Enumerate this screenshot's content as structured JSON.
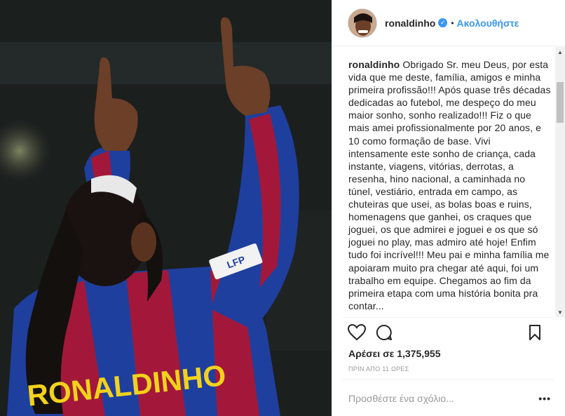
{
  "post": {
    "image_alt": "Ronaldinho pointing upward in a Barcelona jersey",
    "jersey_text": "RONALDINHO",
    "sleeve_badge": "LFP"
  },
  "header": {
    "username": "ronaldinho",
    "verified_icon": "verified-badge-icon",
    "separator": "•",
    "follow_label": "Ακολουθήστε"
  },
  "caption": {
    "username": "ronaldinho",
    "text": "Obrigado Sr. meu Deus, por esta vida que me deste, família, amigos e minha primeira profissão!!! Após quase três décadas dedicadas ao futebol, me despeço do meu maior sonho, sonho realizado!!! Fiz o que mais amei profissionalmente por 20 anos, e 10 como formação de base. Vivi intensamente este sonho de criança, cada instante, viagens, vitórias, derrotas, a resenha, hino nacional, a caminhada no túnel, vestiário, entrada em campo, as chuteiras que usei, as bolas boas e ruins, homenagens que ganhei, os craques que joguei, os que admirei e joguei e os que só joguei no play, mas admiro até hoje! Enfim tudo foi incrível!!! Meu pai e minha família me apoiaram muito pra chegar até aqui, foi um trabalho em equipe. Chegamos ao fim da primeira etapa com uma história bonita pra contar..."
  },
  "scrollbar": {
    "up_glyph": "▲",
    "down_glyph": "▼"
  },
  "actions": {
    "like_icon": "heart-icon",
    "comment_icon": "comment-bubble-icon",
    "save_icon": "bookmark-icon"
  },
  "likes_text": "Αρέσει σε 1,375,955",
  "timestamp": "ΠΡΙΝ ΑΠΟ 11 ΩΡΕΣ",
  "comment": {
    "placeholder": "Προσθέστε ένα σχόλιο...",
    "more_label": "•••"
  },
  "colors": {
    "accent": "#3897f0",
    "text": "#262626",
    "muted": "#999999",
    "jersey_blue": "#1f3f9e",
    "jersey_red": "#a3183a",
    "jersey_yellow": "#f2d21b"
  }
}
